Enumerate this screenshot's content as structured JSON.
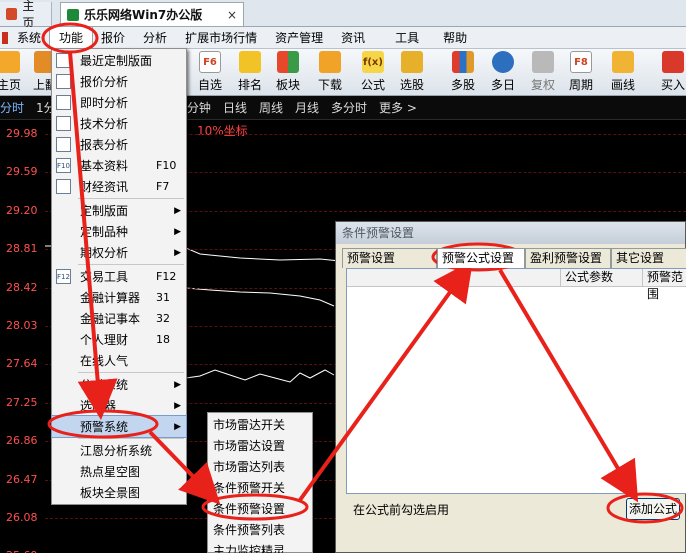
{
  "tabs": {
    "home": "主页",
    "main": "乐乐网络Win7办公版",
    "close": "×"
  },
  "menubar": [
    "系统",
    "功能",
    "报价",
    "分析",
    "扩展市场行情",
    "资产管理",
    "资讯",
    "工具",
    "帮助"
  ],
  "toolbar": [
    "主页",
    "上翻",
    "F6\n自选",
    "排名",
    "板块",
    "下载",
    "公式",
    "选股",
    "多股",
    "多日",
    "复权",
    "F8\n周期",
    "画线",
    "买入"
  ],
  "toolbar_labels": [
    "主页",
    "上翻",
    "自选",
    "排名",
    "板块",
    "下载",
    "公式",
    "选股",
    "多股",
    "多日",
    "复权",
    "周期",
    "画线",
    "买入"
  ],
  "periods": [
    "分时",
    "1分钟",
    "60分钟",
    "日线",
    "周线",
    "月线",
    "多分时",
    "更多 >"
  ],
  "chart": {
    "title": "10%坐标",
    "prices": [
      "29.98",
      "29.59",
      "29.20",
      "28.81",
      "28.42",
      "28.03",
      "27.64",
      "27.25",
      "26.86",
      "26.47",
      "26.08",
      "25.69"
    ],
    "colors": {
      "price": "#ff5050",
      "line": "#ffffff",
      "grid": "#5a1010"
    }
  },
  "dropdown": {
    "items": [
      {
        "label": "最近定制版面",
        "shortcut": "",
        "arrow": false,
        "icon": "layout"
      },
      {
        "label": "报价分析",
        "shortcut": "",
        "arrow": false,
        "icon": "grid"
      },
      {
        "label": "即时分析",
        "shortcut": "",
        "arrow": false,
        "icon": "line"
      },
      {
        "label": "技术分析",
        "shortcut": "",
        "arrow": false,
        "icon": "candle"
      },
      {
        "label": "报表分析",
        "shortcut": "",
        "arrow": false,
        "icon": "table"
      },
      {
        "label": "基本资料",
        "shortcut": "F10",
        "arrow": false,
        "icon": "F10"
      },
      {
        "label": "财经资讯",
        "shortcut": "F7",
        "arrow": false,
        "icon": "news"
      },
      {
        "label": "定制版面",
        "shortcut": "",
        "arrow": true,
        "icon": ""
      },
      {
        "label": "定制品种",
        "shortcut": "",
        "arrow": true,
        "icon": ""
      },
      {
        "label": "期权分析",
        "shortcut": "",
        "arrow": true,
        "icon": ""
      },
      {
        "label": "交易工具",
        "shortcut": "F12",
        "arrow": false,
        "icon": "F12"
      },
      {
        "label": "金融计算器",
        "shortcut": "31",
        "arrow": false,
        "icon": ""
      },
      {
        "label": "金融记事本",
        "shortcut": "32",
        "arrow": false,
        "icon": ""
      },
      {
        "label": "个人理财",
        "shortcut": "18",
        "arrow": false,
        "icon": ""
      },
      {
        "label": "在线人气",
        "shortcut": "",
        "arrow": false,
        "icon": ""
      },
      {
        "label": "公式系统",
        "shortcut": "",
        "arrow": true,
        "icon": ""
      },
      {
        "label": "选股器",
        "shortcut": "",
        "arrow": true,
        "icon": ""
      },
      {
        "label": "预警系统",
        "shortcut": "",
        "arrow": true,
        "icon": ""
      },
      {
        "label": "江恩分析系统",
        "shortcut": "",
        "arrow": false,
        "icon": ""
      },
      {
        "label": "热点星空图",
        "shortcut": "",
        "arrow": false,
        "icon": ""
      },
      {
        "label": "板块全景图",
        "shortcut": "",
        "arrow": false,
        "icon": ""
      }
    ]
  },
  "submenu": [
    "市场雷达开关",
    "市场雷达设置",
    "市场雷达列表",
    "条件预警开关",
    "条件预警设置",
    "条件预警列表",
    "主力监控精灵"
  ],
  "dialog": {
    "title": "条件预警设置",
    "tabs": [
      "预警设置",
      "预警公式设置",
      "盈利预警设置",
      "其它设置"
    ],
    "columns": [
      "公式参数",
      "预警范围"
    ],
    "hint": "在公式前勾选启用",
    "add_button": "添加公式"
  },
  "annotation_color": "#e8221a"
}
